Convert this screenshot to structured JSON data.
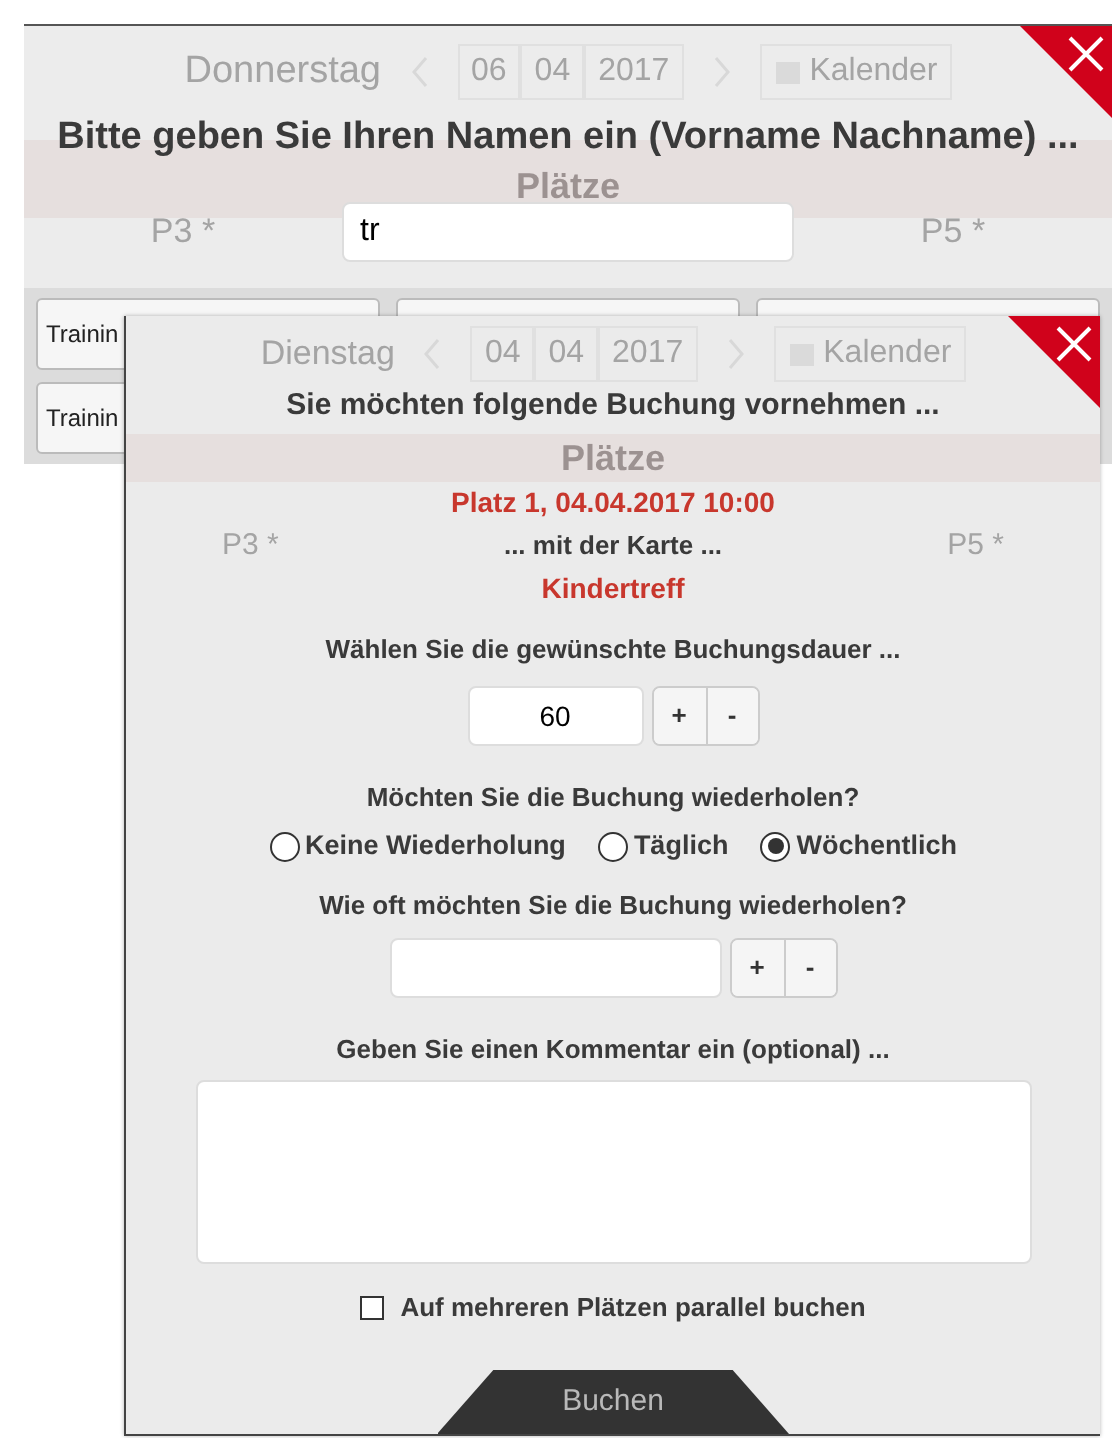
{
  "name_dialog": {
    "ghost_nav": {
      "day": "Donnerstag",
      "date_parts": [
        "06",
        "04",
        "2017"
      ],
      "calendar": "Kalender"
    },
    "title": "Bitte geben Sie Ihren Namen ein (Vorname Nachname) ...",
    "ghost_section": "Plätze",
    "ghost_columns": [
      "P3 *",
      "P5 *"
    ],
    "name_field": {
      "value": "tr"
    },
    "buttons": [
      {
        "label": "Trainin"
      },
      {
        "label": "Trainin"
      }
    ]
  },
  "booking_dialog": {
    "ghost_nav": {
      "day": "Dienstag",
      "date_parts": [
        "04",
        "04",
        "2017"
      ],
      "calendar": "Kalender"
    },
    "title": "Sie möchten folgende Buchung vornehmen ...",
    "ghost_section": "Plätze",
    "slot": "Platz 1, 04.04.2017 10:00",
    "ghost_columns": [
      "P3 *",
      "P5 *"
    ],
    "card_intro": "... mit der Karte ...",
    "card": "Kindertreff",
    "duration_label": "Wählen Sie die gewünschte Buchungsdauer ...",
    "duration": {
      "value": "60",
      "buttons": [
        "+",
        "-"
      ]
    },
    "repeat_label": "Möchten Sie die Buchung wiederholen?",
    "repeat_options": [
      {
        "label": "Keine Wiederholung",
        "selected": false
      },
      {
        "label": "Täglich",
        "selected": false
      },
      {
        "label": "Wöchentlich",
        "selected": true
      }
    ],
    "count_label": "Wie oft möchten Sie die Buchung wiederholen?",
    "count": {
      "buttons": [
        "+",
        "-"
      ]
    },
    "comment_label": "Geben Sie einen Kommentar ein (optional) ...",
    "parallel": {
      "label": "Auf mehreren Plätzen parallel buchen",
      "checked": false
    },
    "submit": "Buchen"
  }
}
